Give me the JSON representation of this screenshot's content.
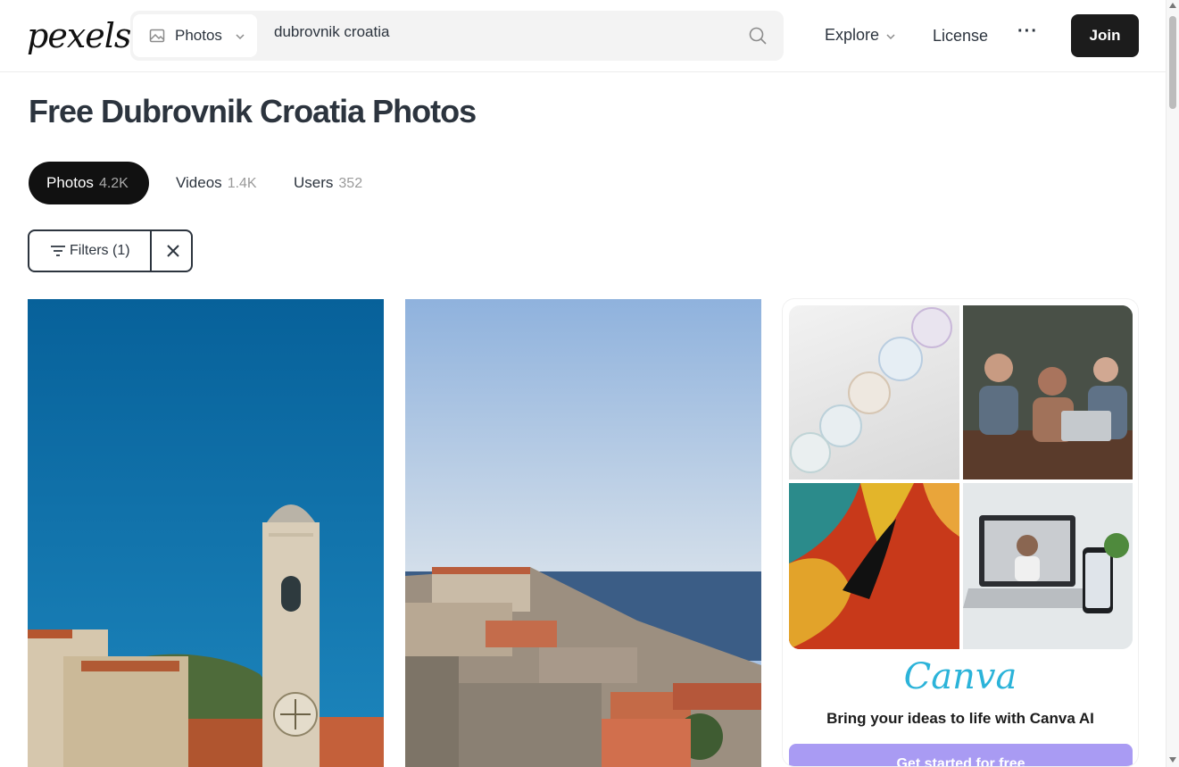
{
  "header": {
    "logo": "pexels",
    "search": {
      "type_label": "Photos",
      "query": "dubrovnik croatia"
    },
    "nav": {
      "explore": "Explore",
      "license": "License",
      "more": "···",
      "join": "Join"
    }
  },
  "main": {
    "title": "Free Dubrovnik Croatia Photos",
    "tabs": [
      {
        "label": "Photos",
        "count": "4.2K",
        "active": true
      },
      {
        "label": "Videos",
        "count": "1.4K",
        "active": false
      },
      {
        "label": "Users",
        "count": "352",
        "active": false
      }
    ],
    "filters": {
      "label": "Filters (1)",
      "clear": "✕"
    }
  },
  "ad": {
    "brand": "Canva",
    "headline": "Bring your ideas to life with Canva AI",
    "cta": "Get started for free"
  },
  "colors": {
    "primary_dark": "#1c1c1c",
    "text": "#2c343e",
    "muted": "#9a9a9a",
    "canva_cta": "#a99bf3"
  }
}
